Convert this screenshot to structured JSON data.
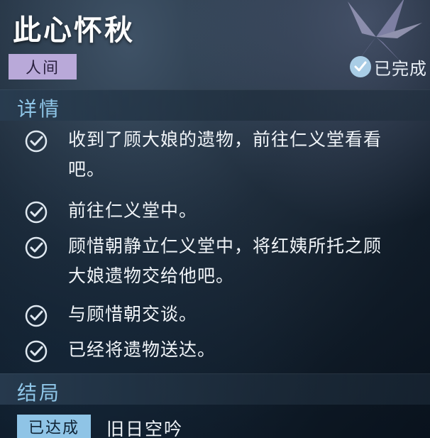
{
  "quest": {
    "title": "此心怀秋",
    "category": "人间",
    "status": "已完成"
  },
  "details": {
    "heading": "详情",
    "tasks": [
      {
        "text_line1": "收到了顾大娘的遗物，前往仁义堂看看",
        "text_line2": "吧。",
        "done": true
      },
      {
        "text_line1": "前往仁义堂中。",
        "text_line2": "",
        "done": true
      },
      {
        "text_line1": "顾惜朝静立仁义堂中，将红姨所托之顾",
        "text_line2": "大娘遗物交给他吧。",
        "done": true
      },
      {
        "text_line1": "与顾惜朝交谈。",
        "text_line2": "",
        "done": true
      },
      {
        "text_line1": "已经将遗物送达。",
        "text_line2": "",
        "done": true
      }
    ]
  },
  "ending": {
    "heading": "结局",
    "badge": "已达成",
    "name": "旧日空吟"
  },
  "colors": {
    "accent_blue": "#8fc6e8",
    "tag_purple": "#b9a9d9",
    "badge_blue": "#8fc4e6"
  }
}
